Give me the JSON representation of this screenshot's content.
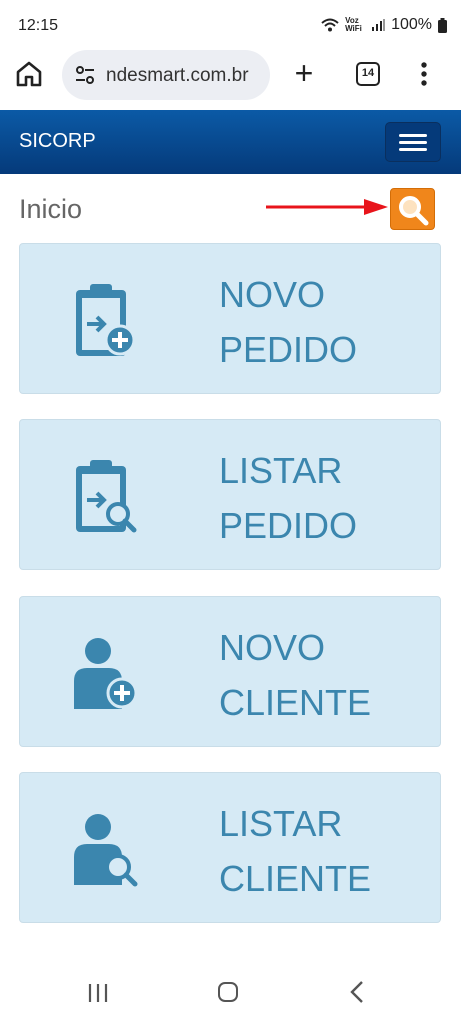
{
  "status_bar": {
    "time": "12:15",
    "network_label": "Voz WiFi",
    "battery": "100%"
  },
  "browser": {
    "url": "ndesmart.com.br",
    "tab_count": "14",
    "new_tab_label": "+"
  },
  "navbar": {
    "brand": "SICORP"
  },
  "page": {
    "title": "Inicio"
  },
  "cards": [
    {
      "line1": "NOVO",
      "line2": "PEDIDO",
      "icon": "clipboard-add-icon"
    },
    {
      "line1": "LISTAR",
      "line2": "PEDIDO",
      "icon": "clipboard-search-icon"
    },
    {
      "line1": "NOVO",
      "line2": "CLIENTE",
      "icon": "user-add-icon"
    },
    {
      "line1": "LISTAR",
      "line2": "CLIENTE",
      "icon": "user-search-icon"
    }
  ],
  "colors": {
    "navbar": "#0b5aa6",
    "card_background": "#d6eaf5",
    "card_text": "#3b86ae",
    "search_button": "#f0861b",
    "arrow": "#e8141b"
  }
}
